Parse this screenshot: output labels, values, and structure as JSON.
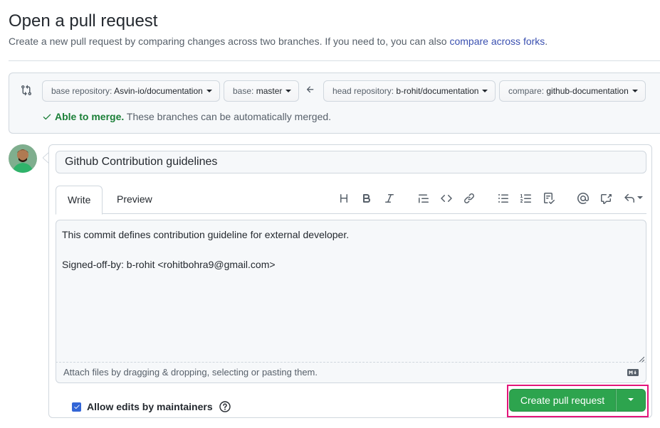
{
  "page": {
    "title": "Open a pull request",
    "subtitle_text": "Create a new pull request by comparing changes across two branches. If you need to, you can also ",
    "subtitle_link": "compare across forks",
    "subtitle_end": "."
  },
  "range": {
    "base_repo_label": "base repository: ",
    "base_repo_value": "Asvin-io/documentation",
    "base_label": "base: ",
    "base_value": "master",
    "head_repo_label": "head repository: ",
    "head_repo_value": "b-rohit/documentation",
    "compare_label": "compare: ",
    "compare_value": "github-documentation",
    "merge_ok": "Able to merge.",
    "merge_text": " These branches can be automatically merged."
  },
  "composer": {
    "title_value": "Github Contribution guidelines",
    "tabs": [
      {
        "label": "Write",
        "active": true
      },
      {
        "label": "Preview",
        "active": false
      }
    ],
    "toolbar_icons": [
      "heading-icon",
      "bold-icon",
      "italic-icon",
      "quote-icon",
      "code-icon",
      "link-icon",
      "unordered-list-icon",
      "ordered-list-icon",
      "task-list-icon",
      "mention-icon",
      "cross-reference-icon",
      "reply-icon"
    ],
    "body_value": "This commit defines contribution guideline for external developer.\n\nSigned-off-by: b-rohit <rohitbohra9@gmail.com>",
    "attach_text": "Attach files by dragging & dropping, selecting or pasting them.",
    "allow_edits_label": "Allow edits by maintainers",
    "allow_edits_checked": true,
    "create_label": "Create pull request"
  },
  "colors": {
    "primary_green": "#2da44e",
    "merge_green": "#1a7f37",
    "link_blue": "#3a50b0",
    "highlight": "#e3157a"
  }
}
